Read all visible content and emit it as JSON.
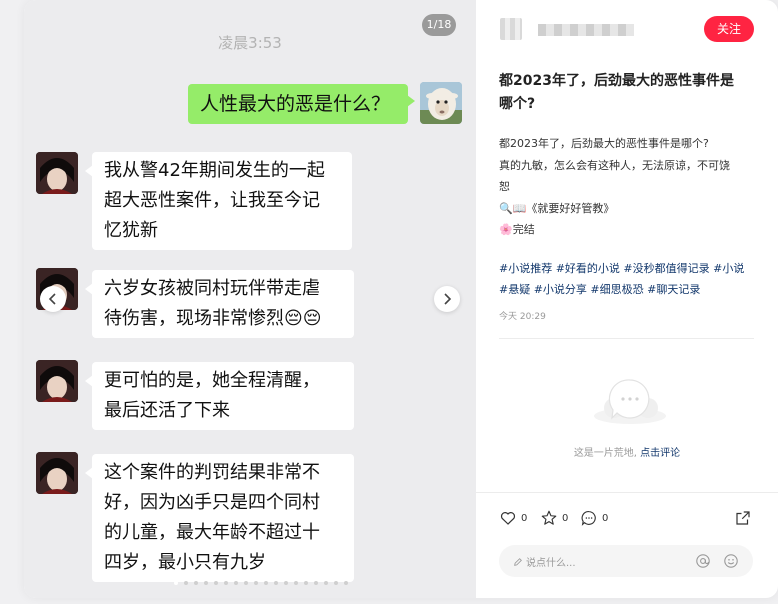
{
  "chat": {
    "time": "凌晨3:53",
    "pager": "1/18",
    "messages": [
      {
        "from": "me",
        "text": "人性最大的恶是什么？"
      },
      {
        "from": "other",
        "lines": [
          "我从警42年期间发生的一起",
          "超大恶性案件，让我至今记",
          "忆犹新"
        ]
      },
      {
        "from": "other",
        "lines": [
          "六岁女孩被同村玩伴带走虐",
          "待伤害，现场非常惨烈😔😔"
        ]
      },
      {
        "from": "other",
        "lines": [
          "更可怕的是，她全程清醒，",
          "最后还活了下来"
        ]
      },
      {
        "from": "other",
        "lines": [
          "这个案件的判罚结果非常不",
          "好，因为凶手只是四个同村",
          "的儿童，最大年龄不超过十",
          "四岁，最小只有九岁"
        ]
      }
    ],
    "prev_icon": "chevron-left-icon",
    "next_icon": "chevron-right-icon"
  },
  "note": {
    "follow_label": "关注",
    "title_lines": [
      "都2023年了，后劲最大的恶性事件是",
      "哪个?"
    ],
    "desc_lines": [
      "都2023年了，后劲最大的恶性事件是哪个?",
      "真的九敏，怎么会有这种人，无法原谅，不可饶",
      "恕"
    ],
    "book": "《就要好好管教》",
    "status": "完结",
    "tag_lines": [
      "#小说推荐 #好看的小说 #没秒都值得记录 #小说",
      "#悬疑 #小说分享 #细思极恐 #聊天记录"
    ],
    "date": "今天 20:29"
  },
  "comments": {
    "empty_text": "这是一片荒地, ",
    "empty_link": "点击评论"
  },
  "actions": {
    "likes": "0",
    "collects": "0",
    "comments": "0",
    "comment_placeholder": "说点什么..."
  },
  "colors": {
    "accent": "#ff2442",
    "my_bubble": "#95ec69",
    "link": "#13386c"
  }
}
